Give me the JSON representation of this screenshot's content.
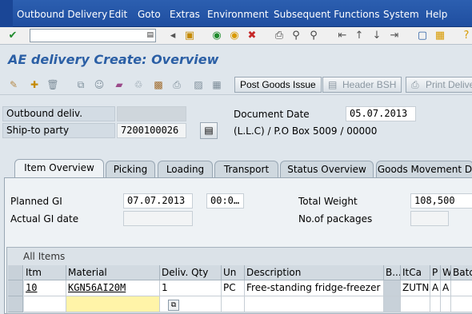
{
  "menu": [
    "Outbound Delivery",
    "Edit",
    "Goto",
    "Extras",
    "Environment",
    "Subsequent Functions",
    "System",
    "Help"
  ],
  "title": "AE delivery  Create: Overview",
  "buttons": {
    "post_goods_issue": "Post Goods Issue",
    "header_bsh": "Header BSH",
    "total_delivery": "Print Delive"
  },
  "header": {
    "outbound_deliv_label": "Outbound deliv.",
    "outbound_deliv_value": "",
    "document_date_label": "Document Date",
    "document_date_value": "05.07.2013",
    "ship_to_label": "Ship-to party",
    "ship_to_value": "7200100026",
    "ship_to_address": "(L.L.C) / P.O Box 5009 / 00000"
  },
  "tabs": [
    "Item Overview",
    "Picking",
    "Loading",
    "Transport",
    "Status Overview",
    "Goods Movement D"
  ],
  "overview": {
    "planned_gi_label": "Planned GI",
    "planned_gi_date": "07.07.2013",
    "planned_gi_time": "00:0…",
    "actual_gi_label": "Actual GI date",
    "total_weight_label": "Total Weight",
    "total_weight_value": "108,500",
    "packages_label": "No.of packages"
  },
  "items_table": {
    "caption": "All Items",
    "columns": [
      "Itm",
      "Material",
      "Deliv. Qty",
      "Un",
      "Description",
      "B...",
      "ItCa",
      "P",
      "W",
      "Batch"
    ],
    "rows": [
      {
        "itm": "10",
        "material": "KGN56AI20M",
        "qty": "1",
        "un": "PC",
        "description": "Free-standing fridge-freezer",
        "b": "",
        "itca": "ZUTN",
        "p": "A",
        "w": "A",
        "batch": ""
      }
    ]
  }
}
